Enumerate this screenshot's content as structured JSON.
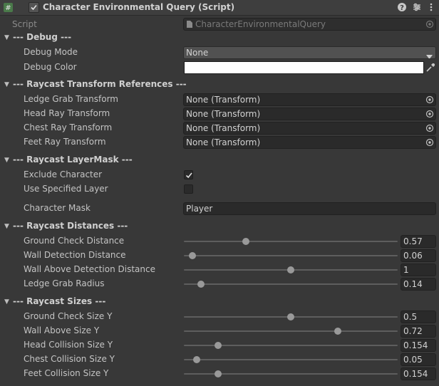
{
  "header": {
    "title": "Character Environmental Query (Script)",
    "enabled": true
  },
  "script": {
    "label": "Script",
    "value": "CharacterEnvironmentalQuery"
  },
  "debug": {
    "section": "--- Debug ---",
    "mode_label": "Debug Mode",
    "mode_value": "None",
    "color_label": "Debug Color",
    "color_value": "#ffffff"
  },
  "transforms": {
    "section": "--- Raycast Transform References ---",
    "items": [
      {
        "label": "Ledge Grab Transform",
        "value": "None (Transform)"
      },
      {
        "label": "Head Ray Transform",
        "value": "None (Transform)"
      },
      {
        "label": "Chest Ray Transform",
        "value": "None (Transform)"
      },
      {
        "label": "Feet Ray Transform",
        "value": "None (Transform)"
      }
    ]
  },
  "layermask": {
    "section": "--- Raycast LayerMask ---",
    "exclude_label": "Exclude Character",
    "exclude_checked": true,
    "specified_label": "Use Specified Layer",
    "specified_checked": false,
    "mask_label": "Character Mask",
    "mask_value": "Player"
  },
  "distances": {
    "section": "--- Raycast Distances ---",
    "items": [
      {
        "label": "Ground Check Distance",
        "value": "0.57",
        "fraction": 0.29
      },
      {
        "label": "Wall Detection Distance",
        "value": "0.06",
        "fraction": 0.04
      },
      {
        "label": "Wall Above Detection Distance",
        "value": "1",
        "fraction": 0.5
      },
      {
        "label": "Ledge Grab Radius",
        "value": "0.14",
        "fraction": 0.08
      }
    ]
  },
  "sizes": {
    "section": "--- Raycast Sizes ---",
    "items": [
      {
        "label": "Ground Check Size Y",
        "value": "0.5",
        "fraction": 0.5
      },
      {
        "label": "Wall Above Size Y",
        "value": "0.72",
        "fraction": 0.72
      },
      {
        "label": "Head Collision Size Y",
        "value": "0.154",
        "fraction": 0.16
      },
      {
        "label": "Chest Collision Size Y",
        "value": "0.05",
        "fraction": 0.06
      },
      {
        "label": "Feet Collision Size Y",
        "value": "0.154",
        "fraction": 0.16
      }
    ]
  },
  "icons": {
    "script": "script-icon",
    "help": "help-icon",
    "presets": "presets-icon",
    "menu": "kebab-menu-icon",
    "object_picker": "object-picker-icon",
    "eyedropper": "eyedropper-icon"
  }
}
